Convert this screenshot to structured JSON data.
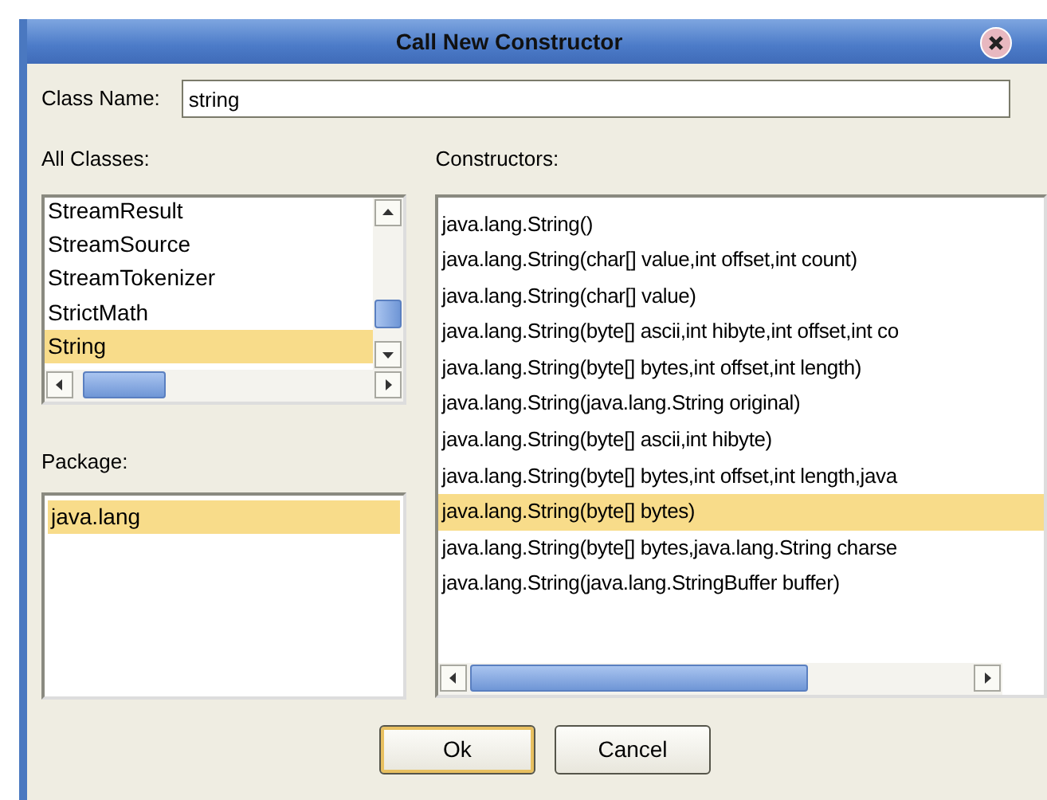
{
  "window": {
    "title": "Call New Constructor"
  },
  "class_name": {
    "label": "Class Name:",
    "value": "string"
  },
  "all_classes": {
    "label": "All Classes:",
    "items": [
      {
        "text": "StreamResult",
        "selected": false
      },
      {
        "text": "StreamSource",
        "selected": false
      },
      {
        "text": "StreamTokenizer",
        "selected": false
      },
      {
        "text": "StrictMath",
        "selected": false
      },
      {
        "text": "String",
        "selected": true
      }
    ]
  },
  "package": {
    "label": "Package:",
    "items": [
      {
        "text": "java.lang",
        "selected": true
      }
    ]
  },
  "constructors": {
    "label": "Constructors:",
    "items": [
      {
        "text": "java.lang.String()",
        "selected": false
      },
      {
        "text": "java.lang.String(char[] value,int offset,int count)",
        "selected": false
      },
      {
        "text": "java.lang.String(char[] value)",
        "selected": false
      },
      {
        "text": "java.lang.String(byte[] ascii,int hibyte,int offset,int co",
        "selected": false
      },
      {
        "text": "java.lang.String(byte[] bytes,int offset,int length)",
        "selected": false
      },
      {
        "text": "java.lang.String(java.lang.String original)",
        "selected": false
      },
      {
        "text": "java.lang.String(byte[] ascii,int hibyte)",
        "selected": false
      },
      {
        "text": "java.lang.String(byte[] bytes,int offset,int length,java",
        "selected": false
      },
      {
        "text": "java.lang.String(byte[] bytes)",
        "selected": true
      },
      {
        "text": "java.lang.String(byte[] bytes,java.lang.String charse",
        "selected": false
      },
      {
        "text": "java.lang.String(java.lang.StringBuffer buffer)",
        "selected": false
      }
    ]
  },
  "buttons": [
    {
      "label": "Ok",
      "default": true
    },
    {
      "label": "Cancel",
      "default": false
    }
  ]
}
